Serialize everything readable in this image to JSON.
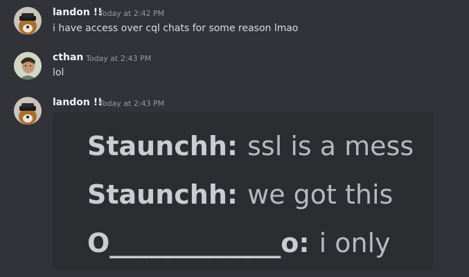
{
  "messages": [
    {
      "username": "landon !!",
      "timestamp": "Today at 2:42 PM",
      "text": "i have access over cql chats for some reason lmao",
      "avatar": "dog-avatar-icon"
    },
    {
      "username": "cthan",
      "timestamp": "Today at 2:43 PM",
      "text": "lol",
      "avatar": "person-avatar-icon"
    },
    {
      "username": "landon !!",
      "timestamp": "Today at 2:43 PM",
      "avatar": "dog-avatar-icon"
    }
  ],
  "embed": {
    "lines": [
      {
        "nick": "Staunchh",
        "text": "ssl is a mess"
      },
      {
        "nick": "Staunchh",
        "text": "we got this"
      },
      {
        "nick": "O_____________o",
        "text": "i only"
      }
    ]
  },
  "colors": {
    "background": "#313338",
    "embed_background": "#2b2d31",
    "username": "#f2f3f5",
    "timestamp": "#949ba4",
    "text": "#dbdee1"
  }
}
